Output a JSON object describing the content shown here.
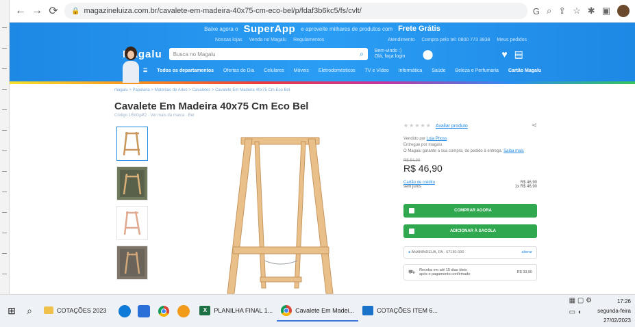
{
  "browser": {
    "url": "magazineluiza.com.br/cavalete-em-madeira-40x75-cm-eco-bel/p/fdaf3b6kc5/fs/cvlt/",
    "icons": [
      "back-icon",
      "forward-icon",
      "reload-icon",
      "lock-icon",
      "google-icon",
      "zoom-icon",
      "share-icon",
      "bookmark-star-icon",
      "extensions-icon",
      "sidepanel-icon",
      "profile-icon"
    ]
  },
  "store": {
    "promo_lead": "Baixe agora o",
    "promo_brand": "SuperApp",
    "promo_mid": "e aproveite milhares de produtos com",
    "promo_frete": "Frete Grátis",
    "utility_links": [
      "Nossas lojas",
      "Venda no Magalu",
      "Regulamentos",
      "Atendimento",
      "Compra pelo tel: 0800 773 3838",
      "Meus pedidos"
    ],
    "logo": "Magalu",
    "search_placeholder": "Busca no Magalu",
    "head_aux": [
      "Bem-vindo :)",
      "Olá, faça login"
    ],
    "categories": [
      "Todos os departamentos",
      "Ofertas do Dia",
      "Celulares",
      "Móveis",
      "Eletrodomésticos",
      "TV e Vídeo",
      "Informática",
      "Saúde",
      "Beleza e Perfumaria",
      "Cartão Magalu"
    ],
    "brand_colors": {
      "primary": "#1e88e5",
      "buy": "#2fa84f"
    }
  },
  "product": {
    "breadcrumb": "magalu > Papelaria > Materiais de Artes > Cavaletes > Cavalete Em Madeira 40x75 Cm Eco Bel",
    "title": "Cavalete Em Madeira 40x75 Cm Eco Bel",
    "subtitle": "Código 1l5d0g4f2 · Ver mais da marca · Bel",
    "rating_link": "Avaliar produto",
    "seller_label": "Vendido por",
    "seller_name": "Loja Phoss",
    "delivery_by": "Entregue por magalu",
    "guarantee": "O Magalu garante a sua compra, do pedido à entrega.",
    "guarantee_link": "Saiba mais",
    "old_price": "R$ 54,90",
    "price": "R$ 46,90",
    "card_label": "Cartão de crédito",
    "card_sub": "sem juros",
    "card_values": [
      "R$ 46,90",
      "1x R$ 46,90"
    ],
    "buy_button": "COMPRAR AGORA",
    "bag_button": "ADICIONAR À SACOLA",
    "location": "ANANINDEUA, PA - 67130-000",
    "location_change": "alterar",
    "shipping_text": "Receba em até 15 dias úteis",
    "shipping_sub": "após o pagamento confirmado",
    "shipping_price": "R$ 33,90"
  },
  "taskbar": {
    "items": [
      {
        "label": "COTAÇÕES 2023",
        "icon": "folder-icon"
      },
      {
        "label": "PLANILHA FINAL 1...",
        "icon": "excel-icon"
      },
      {
        "label": "Cavalete Em Madei...",
        "icon": "chrome-icon"
      },
      {
        "label": "COTAÇÕES ITEM 6...",
        "icon": "outlook-icon"
      }
    ],
    "time": "17:26",
    "day": "segunda-feira",
    "date": "27/02/2023"
  }
}
